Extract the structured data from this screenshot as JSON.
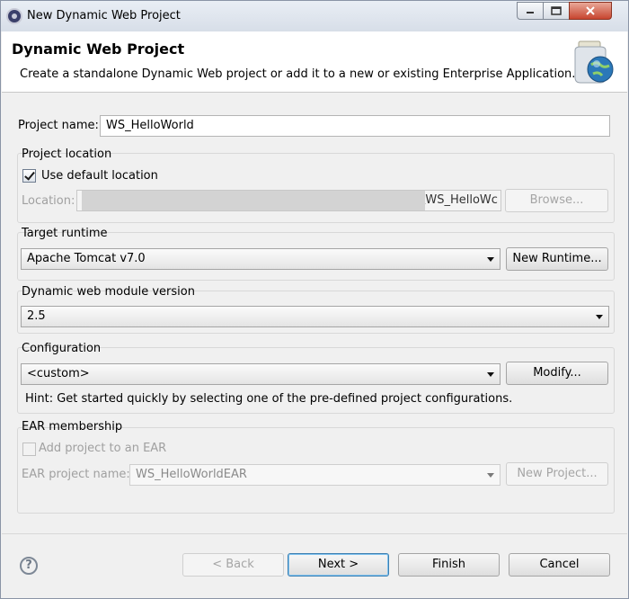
{
  "window": {
    "title": "New Dynamic Web Project"
  },
  "header": {
    "title": "Dynamic Web Project",
    "description": "Create a standalone Dynamic Web project or add it to a new or existing Enterprise Application."
  },
  "project": {
    "name_label": "Project name:",
    "name_value": "WS_HelloWorld"
  },
  "location": {
    "group_label": "Project location",
    "use_default_label": "Use default location",
    "use_default_checked": true,
    "location_label": "Location:",
    "location_suffix": "\\WS_HelloWc",
    "browse_label": "Browse..."
  },
  "runtime": {
    "group_label": "Target runtime",
    "selected": "Apache Tomcat v7.0",
    "new_runtime_label": "New Runtime..."
  },
  "module_version": {
    "group_label": "Dynamic web module version",
    "selected": "2.5"
  },
  "configuration": {
    "group_label": "Configuration",
    "selected": "<custom>",
    "modify_label": "Modify...",
    "hint": "Hint: Get started quickly by selecting one of the pre-defined project configurations."
  },
  "ear": {
    "group_label": "EAR membership",
    "add_label": "Add project to an EAR",
    "add_checked": false,
    "name_label": "EAR project name:",
    "name_value": "WS_HelloWorldEAR",
    "new_project_label": "New Project..."
  },
  "footer": {
    "help_glyph": "?",
    "back_label": "< Back",
    "next_label": "Next >",
    "finish_label": "Finish",
    "cancel_label": "Cancel"
  },
  "colors": {
    "close_button": "#c7452f",
    "default_button_border": "#3c7fb1"
  },
  "icons": [
    "eclipse-app-icon",
    "minimize-icon",
    "maximize-icon",
    "close-icon",
    "web-project-jar-icon",
    "help-icon",
    "dropdown-arrow-icon"
  ]
}
